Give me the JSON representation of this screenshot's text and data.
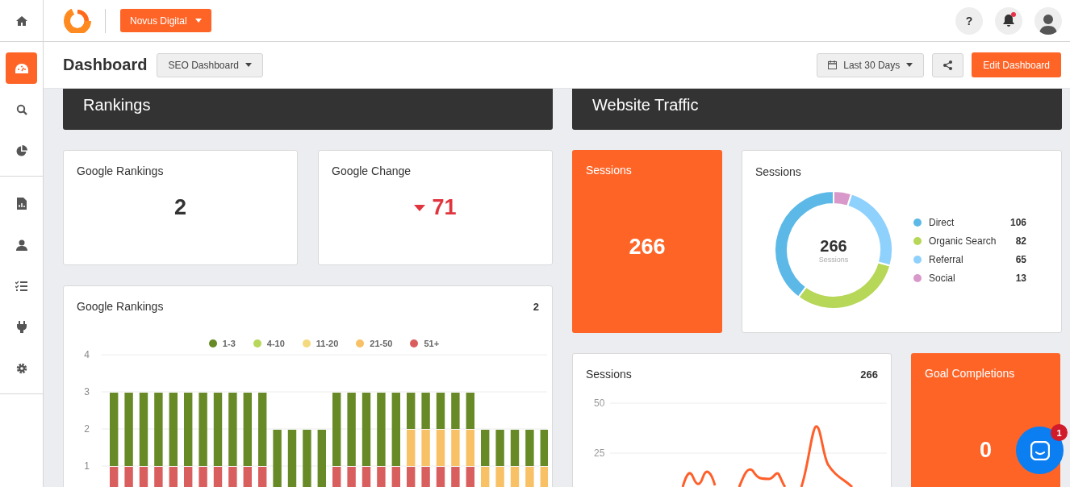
{
  "topbar": {
    "account_menu": "Novus Digital",
    "help_label": "?",
    "notifications": {
      "unread": true
    }
  },
  "sidebar": {
    "groups": [
      [
        {
          "kind": "home",
          "selected": false
        }
      ],
      [
        {
          "kind": "gauge",
          "selected": true
        },
        {
          "kind": "search",
          "selected": false
        },
        {
          "kind": "pie",
          "selected": false
        }
      ],
      [
        {
          "kind": "report",
          "selected": false
        },
        {
          "kind": "user",
          "selected": false
        },
        {
          "kind": "checklist",
          "selected": false
        },
        {
          "kind": "plug",
          "selected": false
        },
        {
          "kind": "gear",
          "selected": false
        }
      ]
    ]
  },
  "page": {
    "title": "Dashboard",
    "dashboard_menu": "SEO Dashboard",
    "date_range": "Last 30 Days",
    "edit_button": "Edit Dashboard"
  },
  "rankings": {
    "title": "Rankings",
    "google_rankings": {
      "label": "Google Rankings",
      "value": "2"
    },
    "google_change": {
      "label": "Google Change",
      "value": "71",
      "decreased": true
    },
    "rankings_chart": {
      "label": "Google Rankings",
      "total": "2",
      "chart_data": {
        "type": "bar",
        "stacked": true,
        "grid": true,
        "ylim": [
          0,
          4
        ],
        "yticks": [
          1,
          2,
          3,
          4
        ],
        "series": [
          {
            "name": "1-3",
            "color": "#678a26",
            "values": [
              2,
              2,
              2,
              2,
              2,
              2,
              2,
              2,
              2,
              2,
              2,
              2,
              2,
              2,
              2,
              2,
              2,
              2,
              2,
              2,
              1,
              1,
              1,
              1,
              1,
              1,
              1,
              1,
              1,
              1
            ]
          },
          {
            "name": "4-10",
            "color": "#b6d75b",
            "values": [
              0,
              0,
              0,
              0,
              0,
              0,
              0,
              0,
              0,
              0,
              0,
              0,
              0,
              0,
              0,
              0,
              0,
              0,
              0,
              0,
              0,
              0,
              0,
              0,
              0,
              0,
              0,
              0,
              0,
              0
            ]
          },
          {
            "name": "11-20",
            "color": "#f4d97f",
            "values": [
              0,
              0,
              0,
              0,
              0,
              0,
              0,
              0,
              0,
              0,
              0,
              0,
              0,
              0,
              0,
              0,
              0,
              0,
              0,
              0,
              0,
              0,
              0,
              0,
              0,
              0,
              0,
              0,
              0,
              0
            ]
          },
          {
            "name": "21-50",
            "color": "#f8c165",
            "values": [
              0,
              0,
              0,
              0,
              0,
              0,
              0,
              0,
              0,
              0,
              0,
              0,
              0,
              0,
              0,
              0,
              0,
              0,
              0,
              0,
              1,
              1,
              1,
              1,
              1,
              1,
              1,
              1,
              1,
              1
            ]
          },
          {
            "name": "51+",
            "color": "#d95f5f",
            "values": [
              1,
              1,
              1,
              1,
              1,
              1,
              1,
              1,
              1,
              1,
              1,
              0,
              0,
              0,
              0,
              1,
              1,
              1,
              1,
              1,
              1,
              1,
              1,
              1,
              1,
              0,
              0,
              0,
              0,
              0
            ]
          }
        ]
      }
    }
  },
  "traffic": {
    "title": "Website Traffic",
    "sessions_tile": {
      "label": "Sessions",
      "value": "266"
    },
    "sessions_breakdown": {
      "label": "Sessions",
      "center_value": "266",
      "center_label": "Sessions",
      "legend": [
        {
          "value": "106",
          "color": "#5cb9e7"
        },
        {
          "value": "82",
          "color": "#b6d757"
        },
        {
          "value": "65",
          "color": "#8fd1fd"
        },
        {
          "value": "13",
          "color": "#d899ca"
        }
      ],
      "chart_data": {
        "type": "donut",
        "categories": [
          "Direct",
          "Organic Search",
          "Referral",
          "Social"
        ],
        "values": [
          39.85,
          30.83,
          24.43,
          4.89
        ]
      }
    },
    "sessions_trend": {
      "label": "Sessions",
      "total": "266",
      "axis_labels": [
        "50",
        "25"
      ]
    },
    "goal_completions": {
      "label": "Goal Completions",
      "value": "0"
    }
  },
  "chat": {
    "unread_count": "1"
  }
}
